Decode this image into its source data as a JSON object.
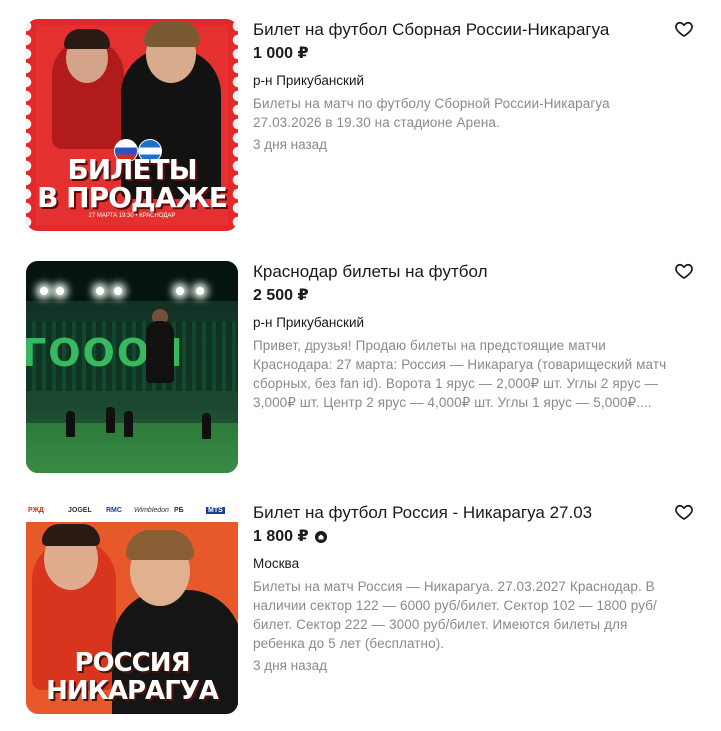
{
  "listings": [
    {
      "title": "Билет на футбол Сборная России-Никарагуа",
      "price": "1 000 ₽",
      "location": "р-н Прикубанский",
      "description": "Билеты на матч по футболу Сборной России-Никарагуа 27.03.2026 в 19.30 на стадионе Арена.",
      "date": "3 дня назад",
      "image": {
        "line1": "БИЛЕТЫ",
        "line2": "В ПРОДАЖЕ",
        "caption": "27 МАРТА 19:30 • КРАСНОДАР"
      }
    },
    {
      "title": "Краснодар билеты на футбол",
      "price": "2 500 ₽",
      "location": "р-н Прикубанский",
      "description": "Привет, друзья! Продаю билеты на предстоящие матчи Краснодара: 27 марта: Россия — Никарагуа (товарищеский матч сборных, без fan id). Ворота 1 ярус — 2,000₽ шт. Углы 2 ярус — 3,000₽ шт. Центр 2 ярус — 4,000₽ шт. Углы 1 ярус — 5,000₽....",
      "date": "",
      "image": {
        "stand_text": "ГОООЛ"
      }
    },
    {
      "title": "Билет на футбол Россия - Никарагуа 27.03",
      "price": "1 800 ₽",
      "location": "Москва",
      "description": "Билеты на матч Россия — Никарагуа. 27.03.2027 Краснодар. В наличии сектор 122 — 6000 руб/билет. Сектор 102 — 1800 руб/билет. Сектор 222 — 3000 руб/билет. Имеются билеты для ребенка до 5 лет (бесплатно).",
      "date": "3 дня назад",
      "image": {
        "line1": "РОССИЯ",
        "line2": "НИКАРАГУА",
        "sponsors": [
          "РЖД",
          "JOGEL",
          "RMC",
          "Wimbledon",
          "PБ",
          "MTS"
        ]
      }
    }
  ],
  "colors": {
    "text": "#1a1a1a",
    "muted": "#8a8a8a",
    "poster_red": "#e3272b",
    "poster_orange": "#e7592a"
  },
  "icons": {
    "favorite": "heart-outline-icon",
    "delivery": "delivery-icon"
  }
}
